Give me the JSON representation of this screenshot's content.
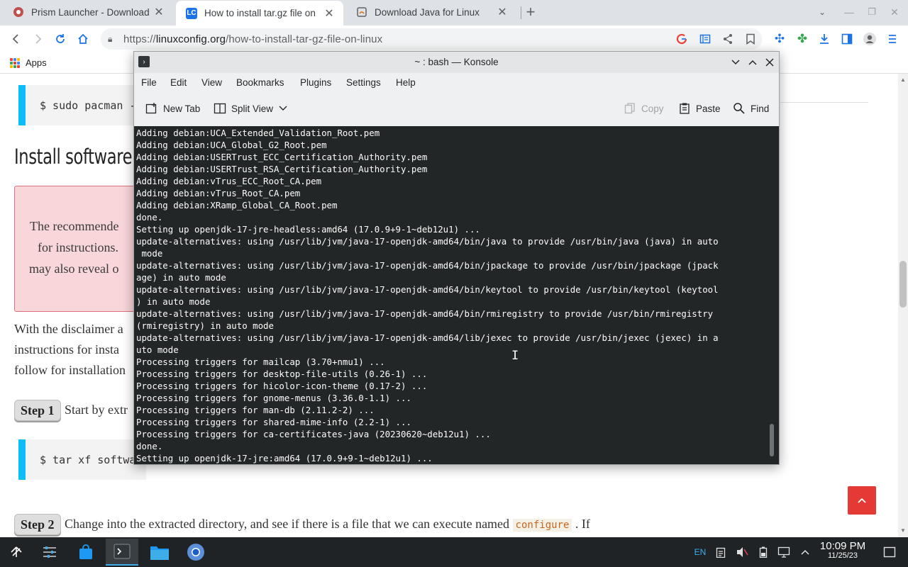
{
  "browser": {
    "tabs": [
      {
        "title": "Prism Launcher - Download",
        "icon": "prism-icon"
      },
      {
        "title": "How to install tar.gz file on",
        "icon": "linuxconfig-icon"
      },
      {
        "title": "Download Java for Linux",
        "icon": "java-icon"
      }
    ],
    "url_prefix": "https://",
    "url_domain": "linuxconfig.org",
    "url_path": "/how-to-install-tar-gz-file-on-linux",
    "bookmarks": {
      "apps_label": "Apps"
    }
  },
  "webpage": {
    "code1": "$ sudo pacman -",
    "heading": "Install software f",
    "warning_lines": [
      "The recommende",
      "for instructions.",
      "may also reveal o"
    ],
    "para_lines": [
      "With the disclaimer a",
      "instructions for insta",
      "follow for installation"
    ],
    "step1_label": "Step 1",
    "step1_text": "Start by extr",
    "code2": "$ tar xf softwa",
    "step2_label": "Step 2",
    "step2_text": "Change into the extracted directory, and see if there is a file that we can execute named",
    "step2_code": "configure",
    "step2_after": ". If",
    "scroll_top_icon": "chevron-up-icon"
  },
  "konsole": {
    "title": "~ : bash — Konsole",
    "menu": [
      "File",
      "Edit",
      "View",
      "Bookmarks",
      "Plugins",
      "Settings",
      "Help"
    ],
    "toolbar": {
      "new_tab": "New Tab",
      "split_view": "Split View",
      "copy": "Copy",
      "paste": "Paste",
      "find": "Find"
    },
    "lines": [
      "Adding debian:UCA_Extended_Validation_Root.pem",
      "Adding debian:UCA_Global_G2_Root.pem",
      "Adding debian:USERTrust_ECC_Certification_Authority.pem",
      "Adding debian:USERTrust_RSA_Certification_Authority.pem",
      "Adding debian:vTrus_ECC_Root_CA.pem",
      "Adding debian:vTrus_Root_CA.pem",
      "Adding debian:XRamp_Global_CA_Root.pem",
      "done.",
      "Setting up openjdk-17-jre-headless:amd64 (17.0.9+9-1~deb12u1) ...",
      "update-alternatives: using /usr/lib/jvm/java-17-openjdk-amd64/bin/java to provide /usr/bin/java (java) in auto",
      " mode",
      "update-alternatives: using /usr/lib/jvm/java-17-openjdk-amd64/bin/jpackage to provide /usr/bin/jpackage (jpack",
      "age) in auto mode",
      "update-alternatives: using /usr/lib/jvm/java-17-openjdk-amd64/bin/keytool to provide /usr/bin/keytool (keytool",
      ") in auto mode",
      "update-alternatives: using /usr/lib/jvm/java-17-openjdk-amd64/bin/rmiregistry to provide /usr/bin/rmiregistry",
      "(rmiregistry) in auto mode",
      "update-alternatives: using /usr/lib/jvm/java-17-openjdk-amd64/lib/jexec to provide /usr/bin/jexec (jexec) in a",
      "uto mode",
      "Processing triggers for mailcap (3.70+nmu1) ...",
      "Processing triggers for desktop-file-utils (0.26-1) ...",
      "Processing triggers for hicolor-icon-theme (0.17-2) ...",
      "Processing triggers for gnome-menus (3.36.0-1.1) ...",
      "Processing triggers for man-db (2.11.2-2) ...",
      "Processing triggers for shared-mime-info (2.2-1) ...",
      "Processing triggers for ca-certificates-java (20230620~deb12u1) ...",
      "done.",
      "Setting up openjdk-17-jre:amd64 (17.0.9+9-1~deb12u1) ..."
    ]
  },
  "taskbar": {
    "keyboard_layout": "EN",
    "time": "10:09 PM",
    "date": "11/25/23"
  },
  "colors": {
    "terminal_bg": "#232627",
    "accent": "#3daee9",
    "code_border": "#0dbdf5",
    "scroll_top_button": "#e53935"
  }
}
